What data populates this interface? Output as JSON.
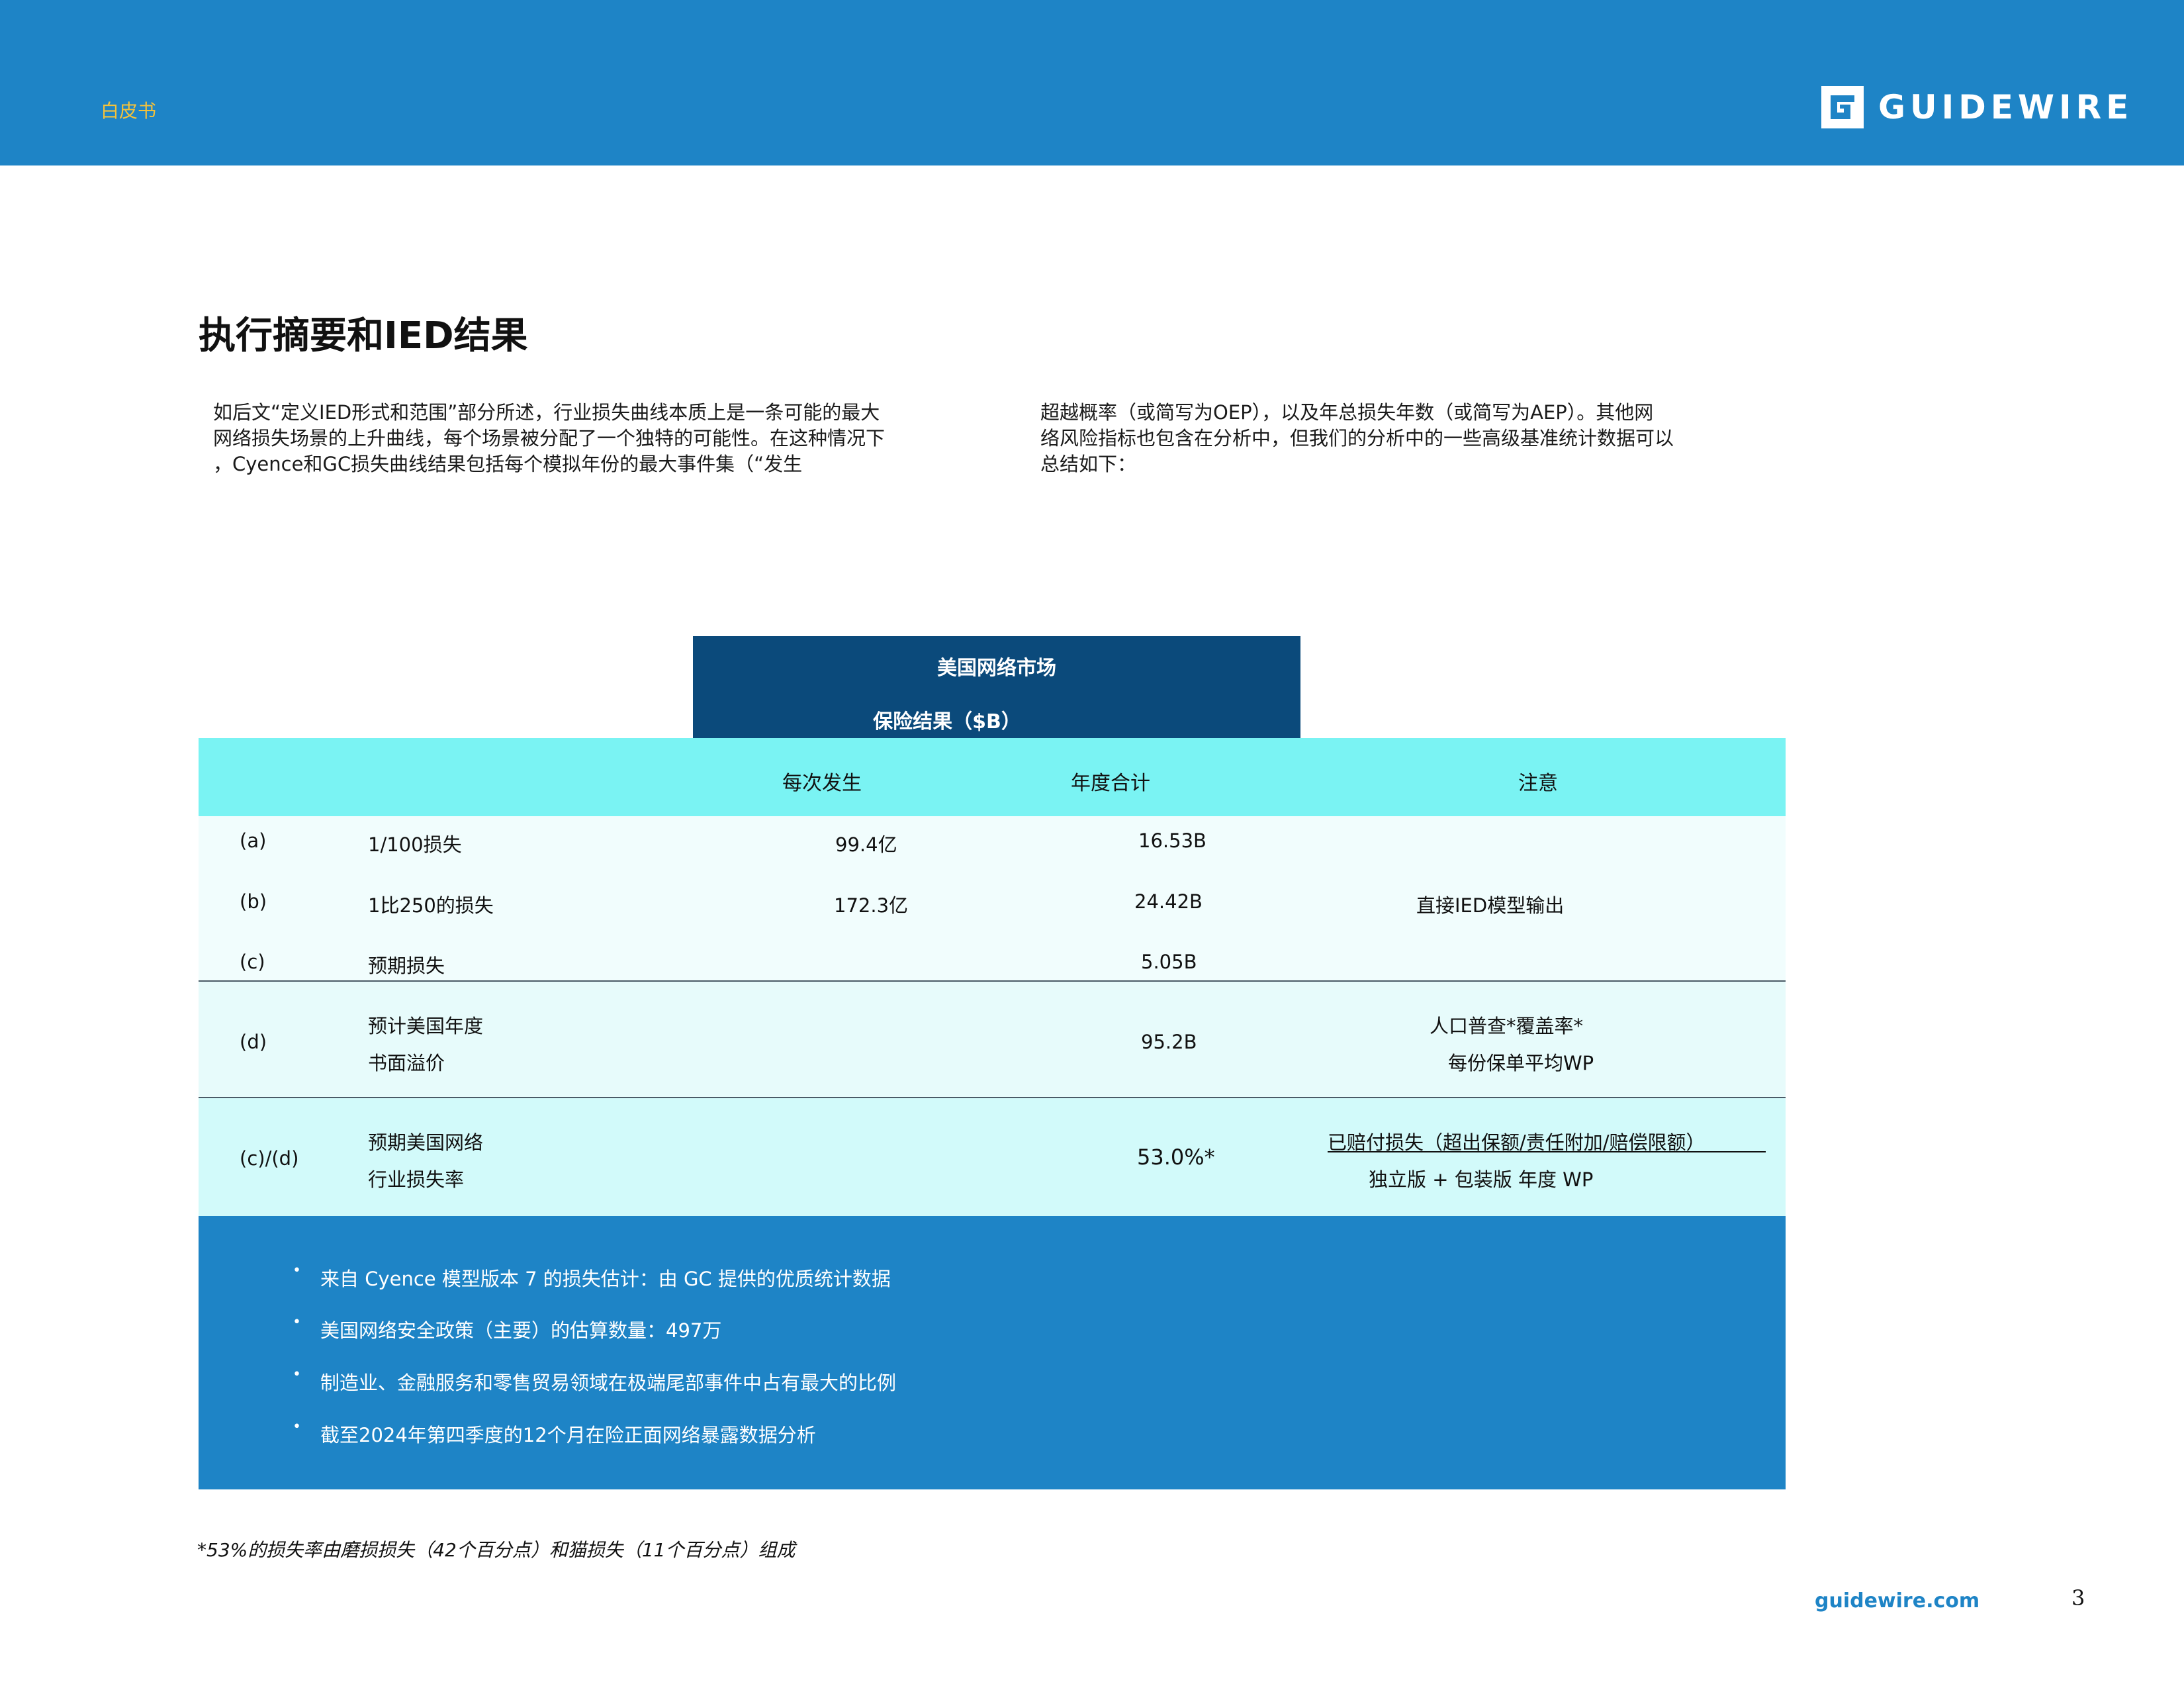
{
  "header": {
    "doc_type": "白皮书",
    "logo_text": "GUIDEWIRE",
    "brand_color": "#1e84c6"
  },
  "title": "执行摘要和IED结果",
  "intro": {
    "left": [
      "如后文“定义IED形式和范围”部分所述，行业损失曲线本质上是一条可能的最大",
      "网络损失场景的上升曲线，每个场景被分配了一个独特的可能性。在这种情况下",
      "，Cyence和GC损失曲线结果包括每个模拟年份的最大事件集（“发生"
    ],
    "right": [
      "超越概率（或简写为OEP），以及年总损失年数（或简写为AEP）。其他网",
      "络风险指标也包含在分析中，但我们的分析中的一些高级基准统计数据可以",
      "总结如下："
    ]
  },
  "table": {
    "header_line1": "美国网络市场",
    "header_line2": "保险结果（$B）",
    "header_color": "#0b4a7b",
    "columns": {
      "occurrence": "每次发生",
      "annual": "年度合计",
      "notes": "注意"
    },
    "rows": {
      "a": {
        "id": "(a)",
        "label": "1/100损失",
        "occurrence": "99.4亿",
        "annual": "16.53B"
      },
      "b": {
        "id": "(b)",
        "label": "1比250的损失",
        "occurrence": "172.3亿",
        "annual": "24.42B",
        "note": "直接IED模型输出"
      },
      "c": {
        "id": "(c)",
        "label": "预期损失",
        "annual": "5.05B"
      },
      "d": {
        "id": "(d)",
        "label_line1": "预计美国年度",
        "label_line2": "书面溢价",
        "annual": "95.2B",
        "note_line1": "人口普查*覆盖率*",
        "note_line2": "每份保单平均WP"
      },
      "cd": {
        "id": "(c)/(d)",
        "label_line1": "预期美国网络",
        "label_line2": "行业损失率",
        "annual": "53.0%*",
        "note_line1": "已赔付损失（超出保额/责任附加/赔偿限额）",
        "note_line2": "独立版 + 包装版 年度 WP"
      }
    }
  },
  "notes": [
    "来自 Cyence 模型版本 7 的损失估计：由 GC 提供的优质统计数据",
    "美国网络安全政策（主要）的估算数量：497万",
    "制造业、金融服务和零售贸易领域在极端尾部事件中占有最大的比例",
    "截至2024年第四季度的12个月在险正面网络暴露数据分析"
  ],
  "footnote": "*53%的损失率由磨损损失（42个百分点）和猫损失（11个百分点）组成",
  "footer": {
    "site": "guidewire.com",
    "page_number": "3"
  }
}
